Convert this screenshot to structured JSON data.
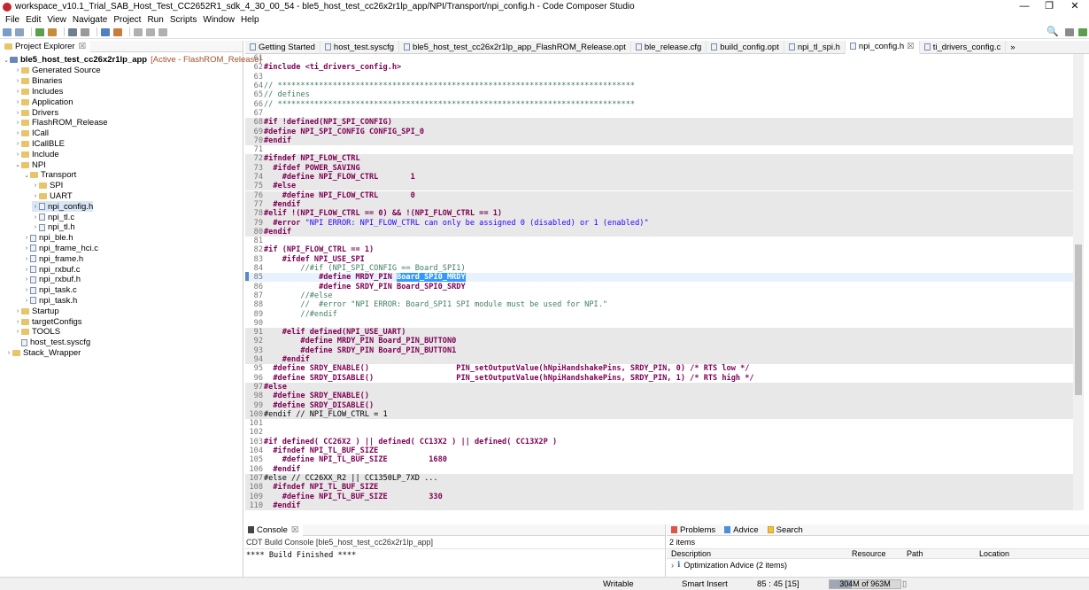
{
  "window": {
    "title": "workspace_v10.1_Trial_SAB_Host_Test_CC2652R1_sdk_4_30_00_54 - ble5_host_test_cc26x2r1lp_app/NPI/Transport/npi_config.h - Code Composer Studio",
    "minimize": "—",
    "maximize": "❐",
    "close": "✕"
  },
  "menu": [
    "File",
    "Edit",
    "View",
    "Navigate",
    "Project",
    "Run",
    "Scripts",
    "Window",
    "Help"
  ],
  "toolbar_right": {
    "search": "🔍"
  },
  "project_explorer": {
    "tab": "Project Explorer",
    "tab_close": "☒",
    "root": {
      "name": "ble5_host_test_cc26x2r1lp_app",
      "status": "[Active - FlashROM_Release]"
    },
    "items": [
      {
        "label": "Generated Source",
        "type": "folder",
        "arrow": "›"
      },
      {
        "label": "Binaries",
        "type": "folder",
        "arrow": "›"
      },
      {
        "label": "Includes",
        "type": "folder",
        "arrow": "›"
      },
      {
        "label": "Application",
        "type": "folder",
        "arrow": "›"
      },
      {
        "label": "Drivers",
        "type": "folder",
        "arrow": "›"
      },
      {
        "label": "FlashROM_Release",
        "type": "folder",
        "arrow": "›"
      },
      {
        "label": "ICall",
        "type": "folder",
        "arrow": "›"
      },
      {
        "label": "ICallBLE",
        "type": "folder",
        "arrow": "›"
      },
      {
        "label": "Include",
        "type": "folder",
        "arrow": "›"
      },
      {
        "label": "NPI",
        "type": "folder",
        "arrow": "⌄"
      },
      {
        "label": "Transport",
        "type": "folder",
        "arrow": "⌄"
      },
      {
        "label": "SPI",
        "type": "folder",
        "arrow": "›"
      },
      {
        "label": "UART",
        "type": "folder",
        "arrow": "›"
      },
      {
        "label": "npi_config.h",
        "type": "file",
        "arrow": "›",
        "selected": true
      },
      {
        "label": "npi_tl.c",
        "type": "file",
        "arrow": "›"
      },
      {
        "label": "npi_tl.h",
        "type": "file",
        "arrow": "›"
      },
      {
        "label": "npi_ble.h",
        "type": "file",
        "arrow": "›"
      },
      {
        "label": "npi_frame_hci.c",
        "type": "file",
        "arrow": "›"
      },
      {
        "label": "npi_frame.h",
        "type": "file",
        "arrow": "›"
      },
      {
        "label": "npi_rxbuf.c",
        "type": "file",
        "arrow": "›"
      },
      {
        "label": "npi_rxbuf.h",
        "type": "file",
        "arrow": "›"
      },
      {
        "label": "npi_task.c",
        "type": "file",
        "arrow": "›"
      },
      {
        "label": "npi_task.h",
        "type": "file",
        "arrow": "›"
      },
      {
        "label": "Startup",
        "type": "folder",
        "arrow": "›"
      },
      {
        "label": "targetConfigs",
        "type": "folder",
        "arrow": "›"
      },
      {
        "label": "TOOLS",
        "type": "folder",
        "arrow": "›"
      },
      {
        "label": "host_test.syscfg",
        "type": "file",
        "arrow": ""
      },
      {
        "label": "Stack_Wrapper",
        "type": "folder",
        "arrow": "›"
      }
    ]
  },
  "editor": {
    "tabs": [
      {
        "label": "Getting Started"
      },
      {
        "label": "host_test.syscfg"
      },
      {
        "label": "ble5_host_test_cc26x2r1lp_app_FlashROM_Release.opt"
      },
      {
        "label": "ble_release.cfg"
      },
      {
        "label": "build_config.opt"
      },
      {
        "label": "npi_tl_spi.h"
      },
      {
        "label": "npi_config.h",
        "active": true
      },
      {
        "label": "ti_drivers_config.c"
      }
    ],
    "overflow": "»",
    "lines": [
      {
        "n": "61",
        "text": ""
      },
      {
        "n": "62",
        "text": "#include <ti_drivers_config.h>"
      },
      {
        "n": "63",
        "text": ""
      },
      {
        "n": "64",
        "text": "// ******************************************************************************"
      },
      {
        "n": "65",
        "text": "// defines"
      },
      {
        "n": "66",
        "text": "// ******************************************************************************"
      },
      {
        "n": "67",
        "text": ""
      },
      {
        "n": "68",
        "text": "#if !defined(NPI_SPI_CONFIG)"
      },
      {
        "n": "69",
        "text": "#define NPI_SPI_CONFIG CONFIG_SPI_0"
      },
      {
        "n": "70",
        "text": "#endif"
      },
      {
        "n": "71",
        "text": ""
      },
      {
        "n": "72",
        "text": "#ifndef NPI_FLOW_CTRL"
      },
      {
        "n": "73",
        "text": "  #ifdef POWER_SAVING"
      },
      {
        "n": "74",
        "text": "    #define NPI_FLOW_CTRL       1"
      },
      {
        "n": "75",
        "text": "  #else"
      },
      {
        "n": "76",
        "text": "    #define NPI_FLOW_CTRL       0"
      },
      {
        "n": "77",
        "text": "  #endif"
      },
      {
        "n": "78",
        "text": "#elif !(NPI_FLOW_CTRL == 0) && !(NPI_FLOW_CTRL == 1)"
      },
      {
        "n": "79",
        "text": "  #error \"NPI ERROR: NPI_FLOW_CTRL can only be assigned 0 (disabled) or 1 (enabled)\""
      },
      {
        "n": "80",
        "text": "#endif"
      },
      {
        "n": "81",
        "text": ""
      },
      {
        "n": "82",
        "text": "#if (NPI_FLOW_CTRL == 1)"
      },
      {
        "n": "83",
        "text": "    #ifdef NPI_USE_SPI"
      },
      {
        "n": "84",
        "text": "        //#if (NPI_SPI_CONFIG == Board_SPI1)"
      },
      {
        "n": "85",
        "text": "            #define MRDY_PIN Board_SPI0_MRDY"
      },
      {
        "n": "86",
        "text": "            #define SRDY_PIN Board_SPI0_SRDY"
      },
      {
        "n": "87",
        "text": "        //#else"
      },
      {
        "n": "88",
        "text": "        //  #error \"NPI ERROR: Board_SPI1 SPI module must be used for NPI.\""
      },
      {
        "n": "89",
        "text": "        //#endif"
      },
      {
        "n": "90",
        "text": ""
      },
      {
        "n": "91",
        "text": "    #elif defined(NPI_USE_UART)"
      },
      {
        "n": "92",
        "text": "        #define MRDY_PIN Board_PIN_BUTTON0"
      },
      {
        "n": "93",
        "text": "        #define SRDY_PIN Board_PIN_BUTTON1"
      },
      {
        "n": "94",
        "text": "    #endif"
      },
      {
        "n": "95",
        "text": "  #define SRDY_ENABLE()                   PIN_setOutputValue(hNpiHandshakePins, SRDY_PIN, 0) /* RTS low */"
      },
      {
        "n": "96",
        "text": "  #define SRDY_DISABLE()                  PIN_setOutputValue(hNpiHandshakePins, SRDY_PIN, 1) /* RTS high */"
      },
      {
        "n": "97",
        "text": "#else"
      },
      {
        "n": "98",
        "text": "  #define SRDY_ENABLE()"
      },
      {
        "n": "99",
        "text": "  #define SRDY_DISABLE()"
      },
      {
        "n": "100",
        "text": "#endif // NPI_FLOW_CTRL = 1"
      },
      {
        "n": "101",
        "text": ""
      },
      {
        "n": "102",
        "text": ""
      },
      {
        "n": "103",
        "text": "#if defined( CC26X2 ) || defined( CC13X2 ) || defined( CC13X2P )"
      },
      {
        "n": "104",
        "text": "  #ifndef NPI_TL_BUF_SIZE"
      },
      {
        "n": "105",
        "text": "    #define NPI_TL_BUF_SIZE         1680"
      },
      {
        "n": "106",
        "text": "  #endif"
      },
      {
        "n": "107",
        "text": "#else // CC26XX_R2 || CC1350LP_7XD ..."
      },
      {
        "n": "108",
        "text": "  #ifndef NPI_TL_BUF_SIZE"
      },
      {
        "n": "109",
        "text": "    #define NPI_TL_BUF_SIZE         330"
      },
      {
        "n": "110",
        "text": "  #endif"
      }
    ],
    "selection": "Board_SPI0_MRDY"
  },
  "console": {
    "tab": "Console",
    "subtitle": "CDT Build Console [ble5_host_test_cc26x2r1lp_app]",
    "output": "**** Build Finished ****"
  },
  "problems": {
    "tabs": [
      "Problems",
      "Advice",
      "Search"
    ],
    "count": "2 items",
    "columns": [
      "Description",
      "Resource",
      "Path",
      "Location"
    ],
    "rows": [
      {
        "description": "Optimization Advice (2 items)"
      }
    ]
  },
  "status": {
    "mode": "Writable",
    "insert": "Smart Insert",
    "position": "85 : 45 [15]",
    "memory": "304M of 963M",
    "memory_fraction": 0.316
  },
  "colors": {
    "keyword": "#7f0055",
    "comment": "#3f7f5f",
    "string": "#2a00ff",
    "selection": "#3399ff"
  }
}
